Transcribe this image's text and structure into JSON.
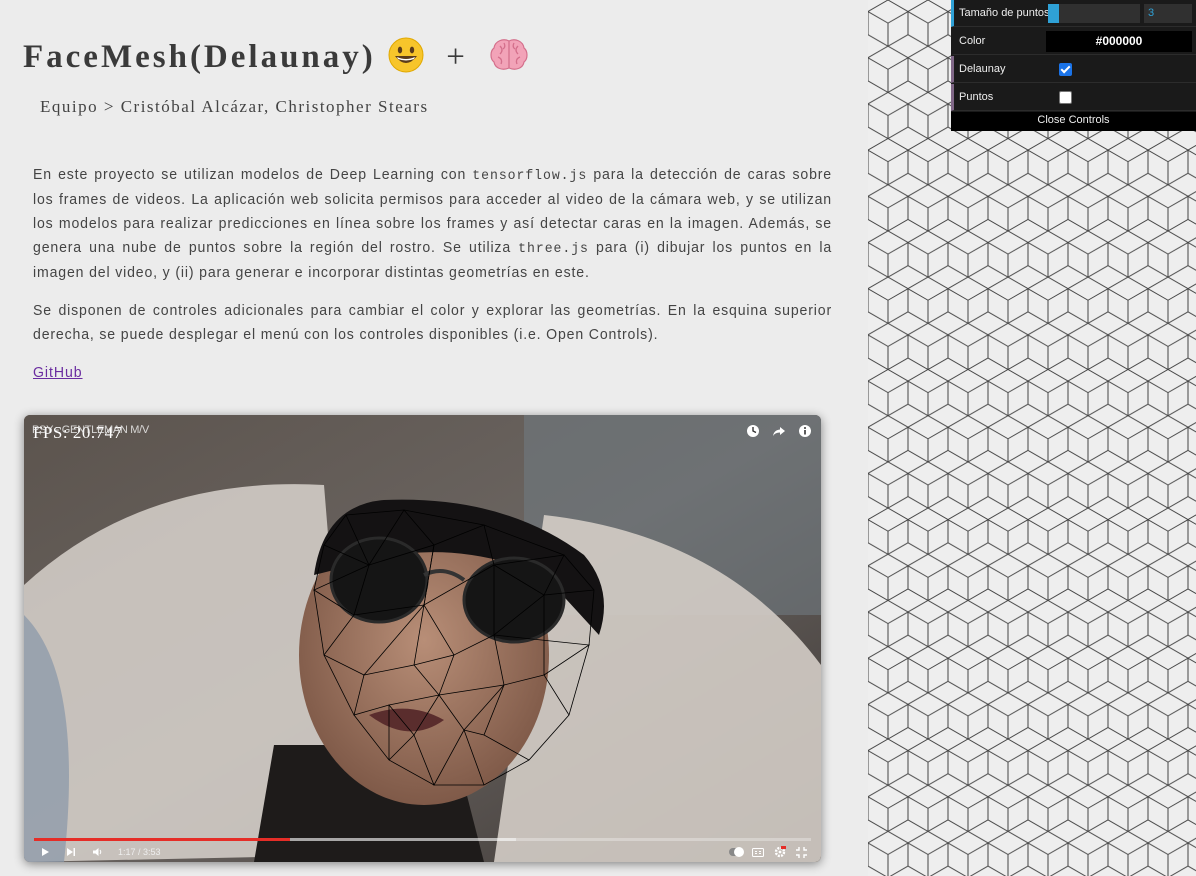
{
  "header": {
    "title": "FaceMesh(Delaunay)",
    "plus": "+",
    "team": "Equipo > Cristóbal Alcázar, Christopher Stears"
  },
  "intro": {
    "p1_a": "En este proyecto se utilizan modelos de Deep Learning con ",
    "p1_code1": "tensorflow.js",
    "p1_b": " para la detección de caras sobre los frames de videos. La aplicación web solicita permisos para acceder al video de la cámara web, y se utilizan los modelos para realizar predicciones en línea sobre los frames y así detectar caras en la imagen. Además, se genera una nube de puntos sobre la región del rostro. Se utiliza ",
    "p1_code2": "three.js",
    "p1_c": " para (i) dibujar los puntos en la imagen del video, y (ii) para generar e incorporar distintas geometrías en este.",
    "p2": "Se disponen de controles adicionales para cambiar el color y explorar las geometrías. En la esquina superior derecha, se puede desplegar el menú con los controles disponibles (i.e. Open Controls).",
    "github": "GitHub"
  },
  "video": {
    "fps": "FPS: 20.747",
    "title": "PSY - GENTLEMAN M/V",
    "time": "1:17 / 3:53",
    "progress": 0.33,
    "buffered": 0.62
  },
  "controls": {
    "size_label": "Tamaño de puntos",
    "size_value": "3",
    "size_fraction": 0.12,
    "color_label": "Color",
    "color_value": "#000000",
    "delaunay_label": "Delaunay",
    "delaunay_checked": true,
    "points_label": "Puntos",
    "points_checked": false,
    "close_label": "Close Controls"
  },
  "colors": {
    "accent_blue": "#2fa1d6",
    "accent_purple": "#806787",
    "youtube_red": "#e52d27",
    "link": "#6a2ca0"
  },
  "icons": [
    "grinning-face-emoji",
    "brain-emoji",
    "clock-icon",
    "share-icon",
    "info-icon",
    "play-icon",
    "next-icon",
    "volume-icon",
    "chevron-down-icon",
    "autoplay-toggle",
    "captions-icon",
    "settings-icon",
    "exit-fullscreen-icon"
  ]
}
